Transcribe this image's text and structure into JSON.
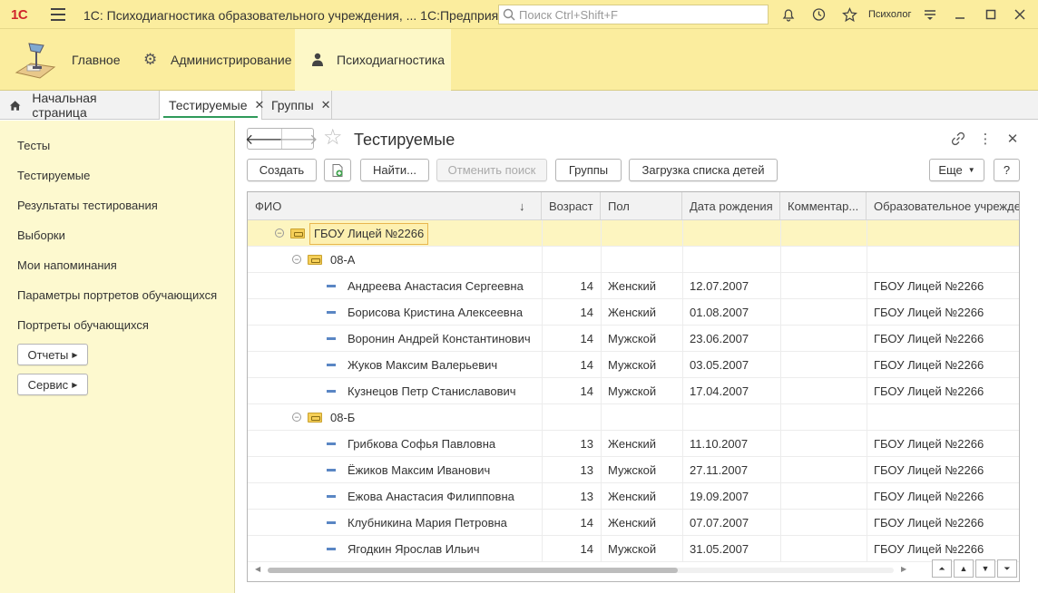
{
  "titlebar": {
    "logo": "1С",
    "title": "1С: Психодиагностика образовательного учреждения, ...  1С:Предприятие",
    "search_placeholder": "Поиск Ctrl+Shift+F",
    "user": "Психолог"
  },
  "sections": [
    {
      "label": "Главное"
    },
    {
      "label": "Администрирование"
    },
    {
      "label": "Психодиагностика"
    }
  ],
  "tabs": [
    {
      "label": "Начальная страница"
    },
    {
      "label": "Тестируемые"
    },
    {
      "label": "Группы"
    }
  ],
  "nav": {
    "items": [
      "Тесты",
      "Тестируемые",
      "Результаты тестирования",
      "Выборки",
      "Мои напоминания",
      "Параметры портретов обучающихся",
      "Портреты обучающихся"
    ],
    "reports": "Отчеты",
    "service": "Сервис"
  },
  "form": {
    "title": "Тестируемые",
    "buttons": {
      "create": "Создать",
      "find": "Найти...",
      "cancel_search": "Отменить поиск",
      "groups": "Группы",
      "load_children": "Загрузка списка детей",
      "more": "Еще",
      "help": "?"
    }
  },
  "table": {
    "columns": [
      "ФИО",
      "Возраст",
      "Пол",
      "Дата рождения",
      "Комментар...",
      "Образовательное учрежде..."
    ],
    "root_group": "ГБОУ Лицей №2266",
    "groups": [
      {
        "name": "08-А",
        "rows": [
          {
            "fio": "Андреева Анастасия Сергеевна",
            "age": "14",
            "sex": "Женский",
            "dob": "12.07.2007",
            "comment": "",
            "org": "ГБОУ Лицей №2266"
          },
          {
            "fio": "Борисова Кристина Алексеевна",
            "age": "14",
            "sex": "Женский",
            "dob": "01.08.2007",
            "comment": "",
            "org": "ГБОУ Лицей №2266"
          },
          {
            "fio": "Воронин Андрей Константинович",
            "age": "14",
            "sex": "Мужской",
            "dob": "23.06.2007",
            "comment": "",
            "org": "ГБОУ Лицей №2266"
          },
          {
            "fio": "Жуков Максим Валерьевич",
            "age": "14",
            "sex": "Мужской",
            "dob": "03.05.2007",
            "comment": "",
            "org": "ГБОУ Лицей №2266"
          },
          {
            "fio": "Кузнецов Петр Станиславович",
            "age": "14",
            "sex": "Мужской",
            "dob": "17.04.2007",
            "comment": "",
            "org": "ГБОУ Лицей №2266"
          }
        ]
      },
      {
        "name": "08-Б",
        "rows": [
          {
            "fio": "Грибкова Софья Павловна",
            "age": "13",
            "sex": "Женский",
            "dob": "11.10.2007",
            "comment": "",
            "org": "ГБОУ Лицей №2266"
          },
          {
            "fio": "Ёжиков Максим Иванович",
            "age": "13",
            "sex": "Мужской",
            "dob": "27.11.2007",
            "comment": "",
            "org": "ГБОУ Лицей №2266"
          },
          {
            "fio": "Ежова Анастасия Филипповна",
            "age": "13",
            "sex": "Женский",
            "dob": "19.09.2007",
            "comment": "",
            "org": "ГБОУ Лицей №2266"
          },
          {
            "fio": "Клубникина Мария Петровна",
            "age": "14",
            "sex": "Женский",
            "dob": "07.07.2007",
            "comment": "",
            "org": "ГБОУ Лицей №2266"
          },
          {
            "fio": "Ягодкин Ярослав Ильич",
            "age": "14",
            "sex": "Мужской",
            "dob": "31.05.2007",
            "comment": "",
            "org": "ГБОУ Лицей №2266"
          }
        ]
      }
    ]
  },
  "colors": {
    "panel_yellow": "#fbed9e",
    "nav_yellow": "#fdf9cf",
    "selection": "#fdf5c0",
    "accent_green": "#2f9a5a",
    "brand_red": "#d0262c"
  }
}
